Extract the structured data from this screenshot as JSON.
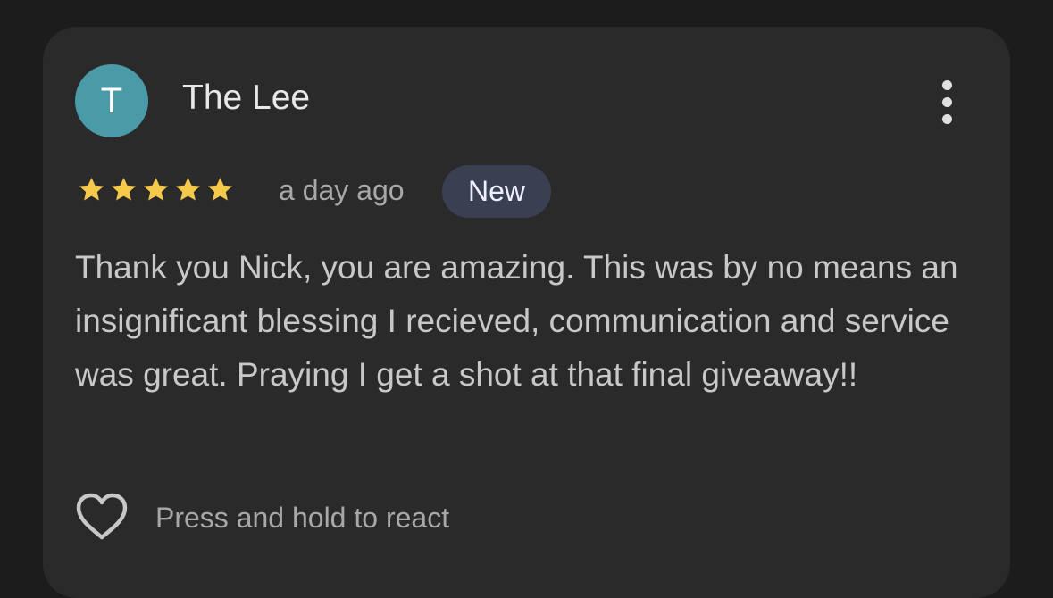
{
  "review": {
    "avatar_letter": "T",
    "avatar_color": "#4a9aa8",
    "reviewer_name": "The Lee",
    "rating": 5,
    "rating_max": 5,
    "star_color": "#f6c94a",
    "timestamp": "a day ago",
    "badge": "New",
    "text": "Thank you Nick, you are amazing. This was by no means an insignificant blessing I recieved, communication and service was great. Praying I get a shot at that final giveaway!!",
    "react_label": "Press and hold to react"
  },
  "icons": {
    "more": "more-vertical-icon",
    "star": "star-icon",
    "react": "heart-outline-icon"
  }
}
